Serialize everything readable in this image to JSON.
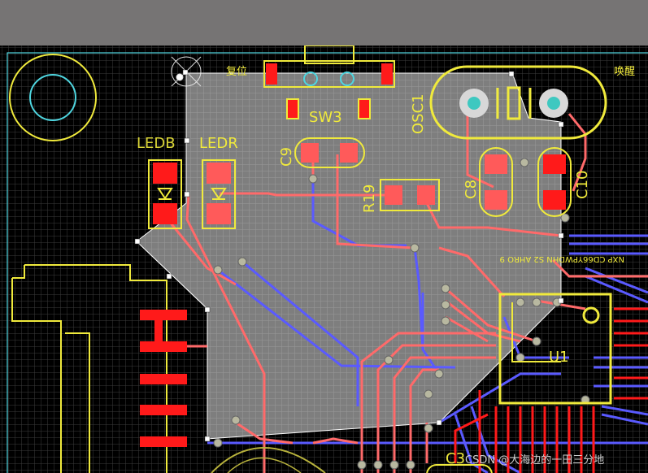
{
  "designators": {
    "sw3": "SW3",
    "osc1": "OSC1",
    "c9": "C9",
    "ledb": "LEDB",
    "ledr": "LEDR",
    "r19": "R19",
    "c8": "C8",
    "c10": "C10",
    "u1": "U1",
    "c3": "C3"
  },
  "silkscreen_text": {
    "reset_label": "复位",
    "wake_label": "唤醒",
    "chip_marking": "NXP CD66YPWDHN S2 AHRO 9"
  },
  "watermark": "CSDN @大海边的一田三分地",
  "colors": {
    "background": "#000000",
    "grid": "#3c3c3c",
    "board_outline": "#4fd6e0",
    "top_layer": "#ff1a1a",
    "top_trace": "#ff6a6a",
    "bottom_trace": "#5a5aff",
    "silkscreen": "#f0ea3c",
    "via": "#b8b8a0",
    "selection_overlay": "#e8e8e8"
  }
}
